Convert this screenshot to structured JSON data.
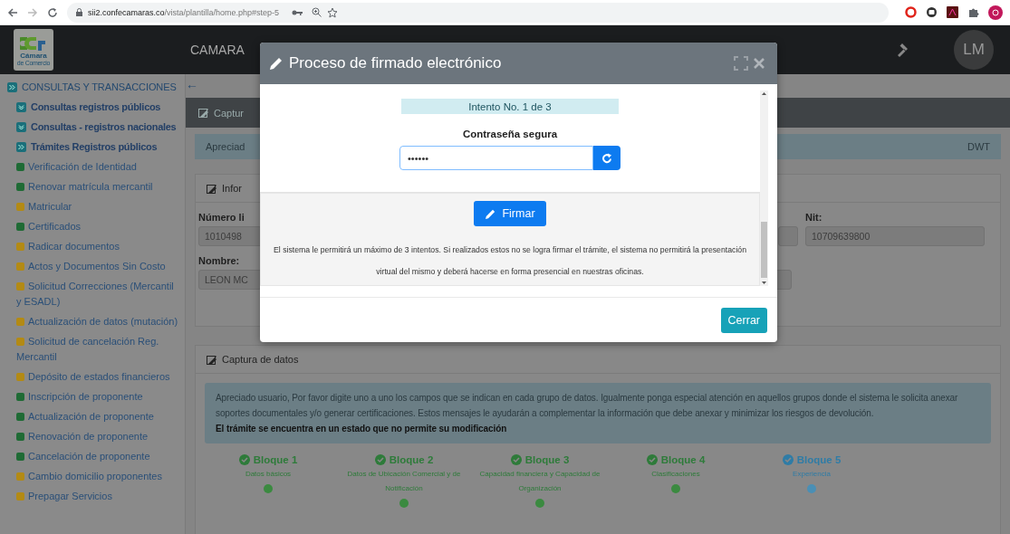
{
  "browser": {
    "url_host": "sii2.confecamaras.co",
    "url_path": "/vista/plantilla/home.php#step-5"
  },
  "header": {
    "logo_lines": [
      "Cámara",
      "de Comercio"
    ],
    "title": "CAMARA",
    "avatar": "LM"
  },
  "sidebar": {
    "items": [
      {
        "label": "CONSULTAS Y TRANSACCIONES",
        "expanded": true,
        "children": [
          {
            "label": "Consultas registros públicos",
            "expanded": false
          },
          {
            "label": "Consultas - registros nacionales",
            "expanded": false
          },
          {
            "label": "Trámites Registros públicos",
            "expanded": true,
            "children": [
              {
                "label": "Verificación de Identidad",
                "color": "#1f6b35"
              },
              {
                "label": "Renovar matrícula mercantil",
                "color": "#1f6b35"
              },
              {
                "label": "Matricular",
                "color": "#b38a14"
              },
              {
                "label": "Certificados",
                "color": "#1f6b35"
              },
              {
                "label": "Radicar documentos",
                "color": "#b38a14"
              },
              {
                "label": "Actos y Documentos Sin Costo",
                "color": "#b38a14"
              },
              {
                "label": "Solicitud Correcciones (Mercantil y ESADL)",
                "color": "#b38a14"
              },
              {
                "label": "Actualización de datos (mutación)",
                "color": "#b38a14"
              },
              {
                "label": "Solicitud de cancelación Reg. Mercantil",
                "color": "#b38a14"
              },
              {
                "label": "Depósito de estados financieros",
                "color": "#b38a14"
              },
              {
                "label": "Inscripción de proponente",
                "color": "#1f6b35"
              },
              {
                "label": "Actualización de proponente",
                "color": "#1f6b35"
              },
              {
                "label": "Renovación de proponente",
                "color": "#1f6b35"
              },
              {
                "label": "Cancelación de proponente",
                "color": "#1f6b35"
              },
              {
                "label": "Cambio domicilio proponentes",
                "color": "#b38a14"
              },
              {
                "label": "Prepagar Servicios",
                "color": "#b38a14"
              }
            ]
          }
        ]
      }
    ]
  },
  "main": {
    "back": "←",
    "panel_title": "Captur",
    "notice": "Apreciad",
    "notice_tail": "DWT",
    "info": {
      "title": "Infor",
      "rows": [
        {
          "left": {
            "label": "Número li",
            "value": "1010498"
          },
          "right": {
            "label": "Nit:",
            "value": "10709639800"
          }
        },
        {
          "left": {
            "label": "Nombre:",
            "value": "LEON MC"
          }
        }
      ]
    },
    "capture": {
      "title": "Captura de datos",
      "message": "Apreciado usuario, Por favor digite uno a uno los campos que se indican en cada grupo de datos. Igualmente ponga especial atención en aquellos grupos donde el sistema le solicita anexar soportes documentales y/o generar certificaciones. Estos mensajes le ayudarán a complementar la información que debe anexar y minimizar los riesgos de devolución.",
      "warning": "El trámite se encuentra en un estado que no permite su modificación",
      "steps": [
        {
          "title": "Bloque 1",
          "subtitle": "Datos básicos",
          "selected": false
        },
        {
          "title": "Bloque 2",
          "subtitle": "Datos de Ubicación Comercial y de Notificación",
          "selected": false
        },
        {
          "title": "Bloque 3",
          "subtitle": "Capacidad financiera y Capacidad de Organización",
          "selected": false
        },
        {
          "title": "Bloque 4",
          "subtitle": "Clasificaciones",
          "selected": false
        },
        {
          "title": "Bloque 5",
          "subtitle": "Experiencia",
          "selected": true
        }
      ]
    }
  },
  "modal": {
    "title": "Proceso de firmado electrónico",
    "attempt": "Intento No. 1 de 3",
    "password_label": "Contraseña segura",
    "password_value": "••••••",
    "sign_button": "Firmar",
    "note": "El sistema le permitirá un máximo de 3 intentos. Si realizados estos no se logra firmar el trámite, el sistema no permitirá la presentación virtual del mismo y deberá hacerse en forma presencial en nuestras oficinas.",
    "close_button": "Cerrar"
  }
}
